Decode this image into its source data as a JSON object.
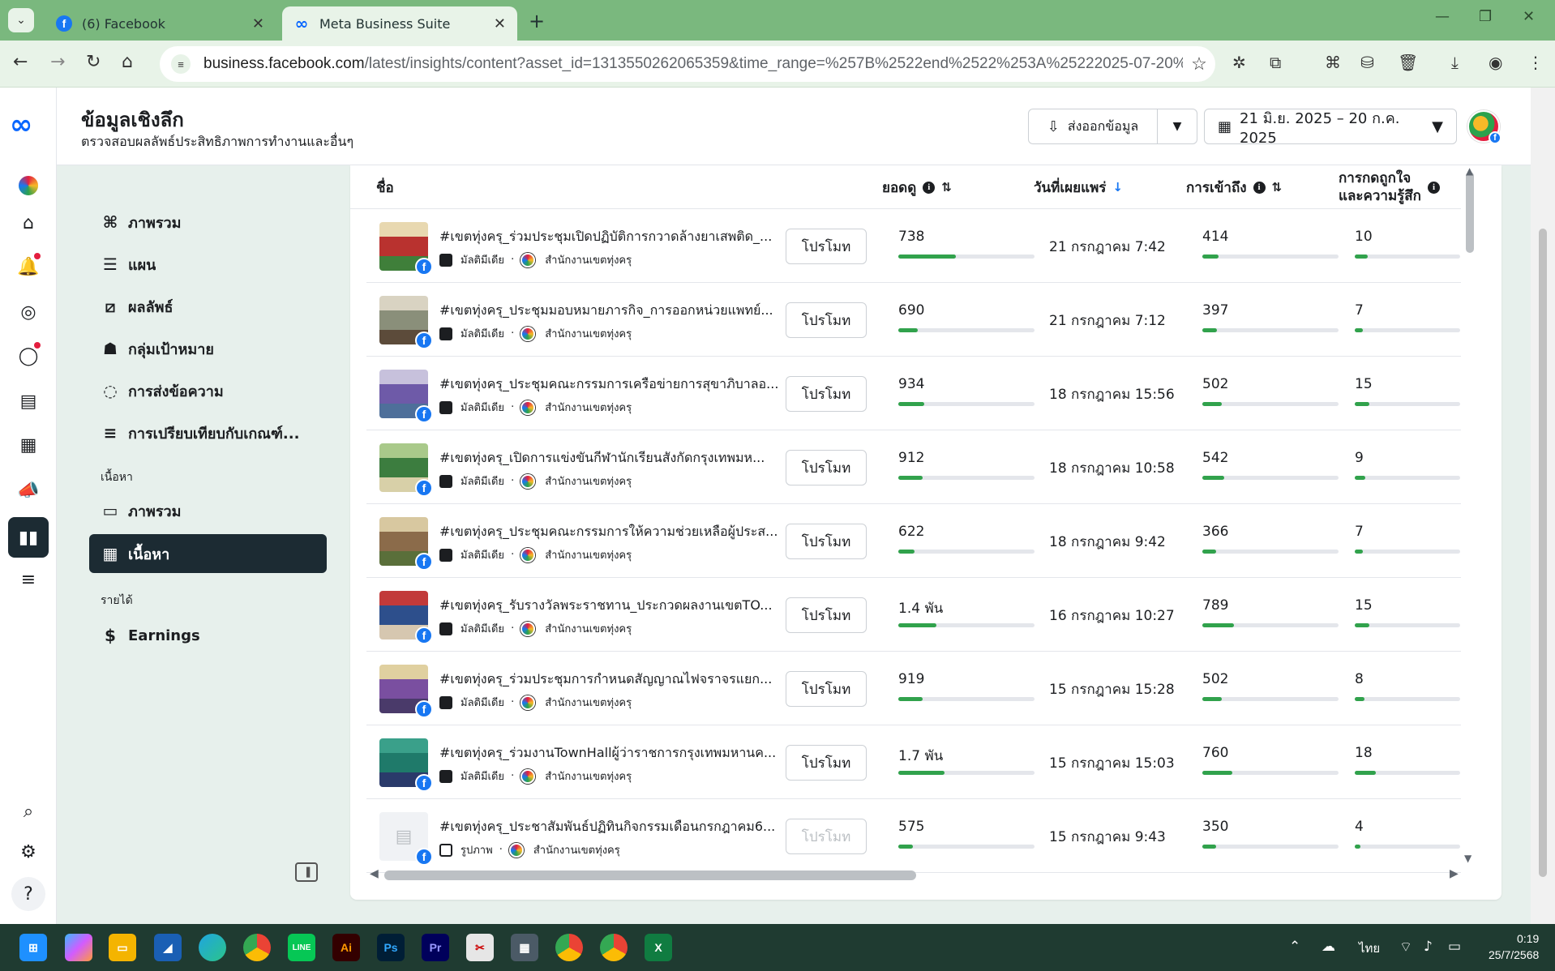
{
  "browser": {
    "tabs": [
      {
        "title": "(6) Facebook",
        "active": false
      },
      {
        "title": "Meta Business Suite",
        "active": true
      }
    ],
    "new_tab_glyph": "+",
    "url_host": "business.facebook.com",
    "url_rest": "/latest/insights/content?asset_id=1313550262065359&time_range=%257B%2522end%2522%253A%25222025-07-20%2522%252C..."
  },
  "header": {
    "title": "ข้อมูลเชิงลึก",
    "subtitle": "ตรวจสอบผลลัพธ์ประสิทธิภาพการทำงานและอื่นๆ",
    "export_label": "ส่งออกข้อมูล",
    "date_range": "21 มิ.ย. 2025 – 20 ก.ค. 2025"
  },
  "leftnav": {
    "items": [
      {
        "label": "ภาพรวม",
        "icon": "overview-icon"
      },
      {
        "label": "แผน",
        "icon": "list-icon"
      },
      {
        "label": "ผลลัพธ์",
        "icon": "results-chart-icon"
      },
      {
        "label": "กลุ่มเป้าหมาย",
        "icon": "audience-icon"
      },
      {
        "label": "การส่งข้อความ",
        "icon": "messaging-icon"
      },
      {
        "label": "การเปรียบเทียบกับเกณฑ์...",
        "icon": "benchmark-icon"
      }
    ],
    "content_section": "เนื้อหา",
    "content_items": [
      {
        "label": "ภาพรวม",
        "icon": "content-overview-icon"
      },
      {
        "label": "เนื้อหา",
        "icon": "table-icon",
        "active": true
      }
    ],
    "revenue_section": "รายได้",
    "revenue_items": [
      {
        "label": "Earnings",
        "icon": "dollar-icon"
      }
    ]
  },
  "table": {
    "columns": {
      "name": "ชื่อ",
      "views": "ยอดดู",
      "published": "วันที่เผยแพร่",
      "reach": "การเข้าถึง",
      "reactions_line1": "การกดถูกใจ",
      "reactions_line2": "และความรู้สึก"
    },
    "promote_label": "โปรโมท",
    "meta_separator": "·",
    "rows": [
      {
        "title": "#เขตทุ่งครุ_ร่วมประชุมเปิดปฏิบัติการกวาดล้างยาเสพติด_...",
        "type": "มัลติมีเดีย",
        "page": "สำนักงานเขตทุ่งครุ",
        "views": "738",
        "views_frac": 0.42,
        "date": "21 กรกฎาคม 7:42",
        "reach": "414",
        "reach_frac": 0.12,
        "reactions": "10",
        "reactions_frac": 0.12,
        "thumb": [
          "#b9322f",
          "#e8d8b0",
          "#3f7f3a"
        ],
        "promote_enabled": true
      },
      {
        "title": "#เขตทุ่งครุ_ประชุมมอบหมายภารกิจ_การออกหน่วยแพทย์...",
        "type": "มัลติมีเดีย",
        "page": "สำนักงานเขตทุ่งครุ",
        "views": "690",
        "views_frac": 0.14,
        "date": "21 กรกฎาคม 7:12",
        "reach": "397",
        "reach_frac": 0.11,
        "reactions": "7",
        "reactions_frac": 0.08,
        "thumb": [
          "#8a8f7a",
          "#d9d3c2",
          "#5c4b3a"
        ],
        "promote_enabled": true
      },
      {
        "title": "#เขตทุ่งครุ_ประชุมคณะกรรมการเครือข่ายการสุขาภิบาลอ...",
        "type": "มัลติมีเดีย",
        "page": "สำนักงานเขตทุ่งครุ",
        "views": "934",
        "views_frac": 0.19,
        "date": "18 กรกฎาคม 15:56",
        "reach": "502",
        "reach_frac": 0.14,
        "reactions": "15",
        "reactions_frac": 0.14,
        "thumb": [
          "#6e5aa8",
          "#c7c1dc",
          "#4e6f9a"
        ],
        "promote_enabled": true
      },
      {
        "title": "#เขตทุ่งครุ_เปิดการแข่งขันกีฬานักเรียนสังกัดกรุงเทพมห...",
        "type": "มัลติมีเดีย",
        "page": "สำนักงานเขตทุ่งครุ",
        "views": "912",
        "views_frac": 0.18,
        "date": "18 กรกฎาคม 10:58",
        "reach": "542",
        "reach_frac": 0.16,
        "reactions": "9",
        "reactions_frac": 0.1,
        "thumb": [
          "#3c7d3f",
          "#a9c98a",
          "#d8d0a8"
        ],
        "promote_enabled": true
      },
      {
        "title": "#เขตทุ่งครุ_ประชุมคณะกรรมการให้ความช่วยเหลือผู้ประส...",
        "type": "มัลติมีเดีย",
        "page": "สำนักงานเขตทุ่งครุ",
        "views": "622",
        "views_frac": 0.12,
        "date": "18 กรกฎาคม 9:42",
        "reach": "366",
        "reach_frac": 0.1,
        "reactions": "7",
        "reactions_frac": 0.08,
        "thumb": [
          "#8b6b4a",
          "#d8c8a0",
          "#5a6f3a"
        ],
        "promote_enabled": true
      },
      {
        "title": "#เขตทุ่งครุ_รับรางวัลพระราชทาน_ประกวดผลงานเขตTO...",
        "type": "มัลติมีเดีย",
        "page": "สำนักงานเขตทุ่งครุ",
        "views": "1.4 พัน",
        "views_frac": 0.28,
        "date": "16 กรกฎาคม 10:27",
        "reach": "789",
        "reach_frac": 0.23,
        "reactions": "15",
        "reactions_frac": 0.14,
        "thumb": [
          "#2d4f8c",
          "#c23a3a",
          "#d6c7b0"
        ],
        "promote_enabled": true
      },
      {
        "title": "#เขตทุ่งครุ_ร่วมประชุมการกำหนดสัญญาณไฟจราจรแยก...",
        "type": "มัลติมีเดีย",
        "page": "สำนักงานเขตทุ่งครุ",
        "views": "919",
        "views_frac": 0.18,
        "date": "15 กรกฎาคม 15:28",
        "reach": "502",
        "reach_frac": 0.14,
        "reactions": "8",
        "reactions_frac": 0.09,
        "thumb": [
          "#7a4fa0",
          "#e0d0a0",
          "#4a3a6a"
        ],
        "promote_enabled": true
      },
      {
        "title": "#เขตทุ่งครุ_ร่วมงานTownHallผู้ว่าราชการกรุงเทพมหานค...",
        "type": "มัลติมีเดีย",
        "page": "สำนักงานเขตทุ่งครุ",
        "views": "1.7 พัน",
        "views_frac": 0.34,
        "date": "15 กรกฎาคม 15:03",
        "reach": "760",
        "reach_frac": 0.22,
        "reactions": "18",
        "reactions_frac": 0.2,
        "thumb": [
          "#1f7a6a",
          "#3aa08a",
          "#2a3a6a"
        ],
        "promote_enabled": true
      },
      {
        "title": "#เขตทุ่งครุ_ประชาสัมพันธ์ปฏิทินกิจกรรมเดือนกรกฎาคม6...",
        "type": "รูปภาพ",
        "page": "สำนักงานเขตทุ่งครุ",
        "views": "575",
        "views_frac": 0.11,
        "date": "15 กรกฎาคม 9:43",
        "reach": "350",
        "reach_frac": 0.1,
        "reactions": "4",
        "reactions_frac": 0.05,
        "thumb": null,
        "promote_enabled": false
      }
    ]
  },
  "taskbar": {
    "apps": [
      "start-icon",
      "copilot-icon",
      "file-explorer-icon",
      "app-icon",
      "edge-icon",
      "chrome-icon",
      "line-icon",
      "illustrator-icon",
      "photoshop-icon",
      "premiere-icon",
      "snipping-icon",
      "calculator-icon",
      "chrome-profile-icon",
      "chrome-profile2-icon",
      "excel-icon"
    ],
    "app_labels": {
      "line": "LINE",
      "ai": "Ai",
      "ps": "Ps",
      "pr": "Pr",
      "xl": "X"
    },
    "language": "ไทย",
    "time": "0:19",
    "date": "25/7/2568"
  },
  "colors": {
    "accent": "#1877f2",
    "bar": "#31a24c",
    "active_nav": "#1c2b33",
    "tab_strip": "#7ab87e"
  }
}
